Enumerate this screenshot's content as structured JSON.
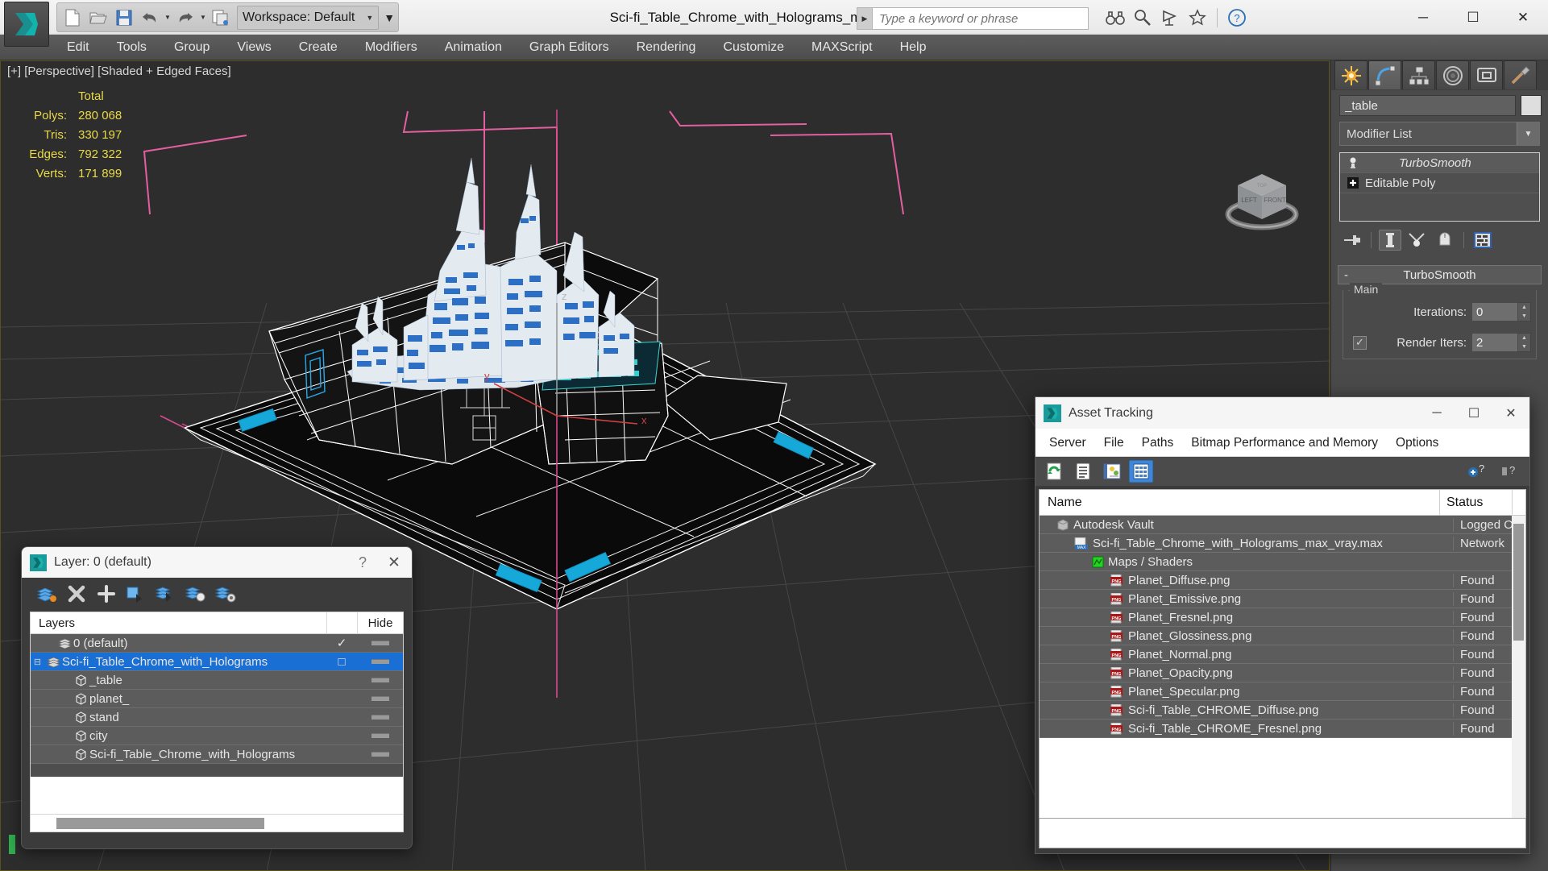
{
  "app": {
    "window_title": "Sci-fi_Table_Chrome_with_Holograms_max_vray.max",
    "workspace_label": "Workspace: Default",
    "search_placeholder": "Type a keyword or phrase",
    "quick_access": [
      {
        "name": "new-file-icon",
        "label": "New"
      },
      {
        "name": "open-file-icon",
        "label": "Open"
      },
      {
        "name": "save-file-icon",
        "label": "Save"
      },
      {
        "name": "undo-icon",
        "label": "Undo"
      },
      {
        "name": "redo-icon",
        "label": "Redo"
      },
      {
        "name": "project-folder-icon",
        "label": "Set Project Folder"
      }
    ],
    "toolbar_icons": [
      {
        "name": "binoculars-icon",
        "label": "Search"
      },
      {
        "name": "magnifier-icon",
        "label": "Find"
      },
      {
        "name": "satellite-dish-icon",
        "label": "Autodesk Online"
      },
      {
        "name": "star-icon",
        "label": "Favorites"
      },
      {
        "name": "help-icon",
        "label": "Help"
      }
    ],
    "window_buttons": [
      {
        "name": "minimize-button",
        "glyph": "─"
      },
      {
        "name": "maximize-button",
        "glyph": "☐"
      },
      {
        "name": "close-button",
        "glyph": "✕"
      }
    ]
  },
  "menubar": {
    "items": [
      "Edit",
      "Tools",
      "Group",
      "Views",
      "Create",
      "Modifiers",
      "Animation",
      "Graph Editors",
      "Rendering",
      "Customize",
      "MAXScript",
      "Help"
    ]
  },
  "viewport": {
    "label": "[+] [Perspective] [Shaded + Edged Faces]",
    "stats_header": "Total",
    "stats": [
      {
        "key": "Polys:",
        "value": "280 068"
      },
      {
        "key": "Tris:",
        "value": "330 197"
      },
      {
        "key": "Edges:",
        "value": "792 322"
      },
      {
        "key": "Verts:",
        "value": "171 899"
      }
    ],
    "axis_labels": {
      "x": "x",
      "y": "y",
      "z": "z"
    },
    "viewcube_faces": {
      "left": "LEFT",
      "front": "FRONT",
      "top": "TOP"
    }
  },
  "command_panel": {
    "tabs": [
      {
        "name": "create-tab",
        "label": "Create"
      },
      {
        "name": "modify-tab",
        "label": "Modify"
      },
      {
        "name": "hierarchy-tab",
        "label": "Hierarchy"
      },
      {
        "name": "motion-tab",
        "label": "Motion"
      },
      {
        "name": "display-tab",
        "label": "Display"
      },
      {
        "name": "utilities-tab",
        "label": "Utilities"
      }
    ],
    "active_tab_index": 1,
    "object_name": "_table",
    "object_color": "#dedede",
    "modifier_list_label": "Modifier List",
    "modifier_stack": [
      {
        "label": "TurboSmooth",
        "selected": true,
        "icon": "lightbulb-icon"
      },
      {
        "label": "Editable Poly",
        "selected": false,
        "icon": "plus-box-icon"
      }
    ],
    "stack_buttons": [
      {
        "name": "pin-stack-button"
      },
      {
        "name": "show-end-result-button"
      },
      {
        "name": "make-unique-button"
      },
      {
        "name": "remove-modifier-button"
      },
      {
        "name": "configure-modifier-sets-button"
      }
    ],
    "rollout": {
      "title": "TurboSmooth",
      "collapse_glyph": "-",
      "group_title": "Main",
      "fields": [
        {
          "label": "Iterations:",
          "value": "0",
          "checkbox": false
        },
        {
          "label": "Render Iters:",
          "value": "2",
          "checkbox": true
        }
      ]
    }
  },
  "layer_dialog": {
    "title": "Layer: 0 (default)",
    "help_glyph": "?",
    "close_glyph": "✕",
    "toolbar": [
      {
        "name": "set-active-layer-icon"
      },
      {
        "name": "delete-layer-icon"
      },
      {
        "name": "create-new-layer-icon"
      },
      {
        "name": "add-selection-to-layer-icon"
      },
      {
        "name": "select-objects-in-layer-icon"
      },
      {
        "name": "select-highlighted-layer-icon"
      },
      {
        "name": "layer-properties-icon"
      }
    ],
    "columns": [
      "Layers",
      "",
      "Hide"
    ],
    "rows": [
      {
        "name": "0 (default)",
        "indent": 1,
        "selected": false,
        "expander": "",
        "active": "✓",
        "icon": "layer-icon",
        "hide_dash": true
      },
      {
        "name": "Sci-fi_Table_Chrome_with_Holograms",
        "indent": 0,
        "selected": true,
        "expander": "⊟",
        "active": "□",
        "icon": "layer-icon",
        "hide_dash": true
      },
      {
        "name": "_table",
        "indent": 2,
        "selected": false,
        "expander": "",
        "active": "",
        "icon": "object-icon",
        "hide_dash": true
      },
      {
        "name": "planet_",
        "indent": 2,
        "selected": false,
        "expander": "",
        "active": "",
        "icon": "object-icon",
        "hide_dash": true
      },
      {
        "name": "stand",
        "indent": 2,
        "selected": false,
        "expander": "",
        "active": "",
        "icon": "object-icon",
        "hide_dash": true
      },
      {
        "name": "city",
        "indent": 2,
        "selected": false,
        "expander": "",
        "active": "",
        "icon": "object-icon",
        "hide_dash": true
      },
      {
        "name": "Sci-fi_Table_Chrome_with_Holograms",
        "indent": 2,
        "selected": false,
        "expander": "",
        "active": "",
        "icon": "object-icon",
        "hide_dash": true
      }
    ]
  },
  "asset_tracking": {
    "title": "Asset Tracking",
    "window_buttons": [
      {
        "name": "at-minimize-button",
        "glyph": "─"
      },
      {
        "name": "at-maximize-button",
        "glyph": "☐"
      },
      {
        "name": "at-close-button",
        "glyph": "✕"
      }
    ],
    "menu": [
      "Server",
      "File",
      "Paths",
      "Bitmap Performance and Memory",
      "Options"
    ],
    "toolbar": [
      {
        "name": "refresh-icon",
        "selected": false
      },
      {
        "name": "list-view-icon",
        "selected": false
      },
      {
        "name": "details-view-icon",
        "selected": false
      },
      {
        "name": "grid-view-icon",
        "selected": true
      }
    ],
    "help_icons": [
      {
        "name": "add-help-icon"
      },
      {
        "name": "question-help-icon"
      }
    ],
    "columns": [
      "Name",
      "Status"
    ],
    "rows": [
      {
        "name": "Autodesk Vault",
        "status": "Logged O",
        "indent": 0,
        "icon": "vault-icon"
      },
      {
        "name": "Sci-fi_Table_Chrome_with_Holograms_max_vray.max",
        "status": "Network",
        "indent": 1,
        "icon": "max-file-icon"
      },
      {
        "name": "Maps / Shaders",
        "status": "",
        "indent": 2,
        "icon": "maps-icon"
      },
      {
        "name": "Planet_Diffuse.png",
        "status": "Found",
        "indent": 3,
        "icon": "png-icon"
      },
      {
        "name": "Planet_Emissive.png",
        "status": "Found",
        "indent": 3,
        "icon": "png-icon"
      },
      {
        "name": "Planet_Fresnel.png",
        "status": "Found",
        "indent": 3,
        "icon": "png-icon"
      },
      {
        "name": "Planet_Glossiness.png",
        "status": "Found",
        "indent": 3,
        "icon": "png-icon"
      },
      {
        "name": "Planet_Normal.png",
        "status": "Found",
        "indent": 3,
        "icon": "png-icon"
      },
      {
        "name": "Planet_Opacity.png",
        "status": "Found",
        "indent": 3,
        "icon": "png-icon"
      },
      {
        "name": "Planet_Specular.png",
        "status": "Found",
        "indent": 3,
        "icon": "png-icon"
      },
      {
        "name": "Sci-fi_Table_CHROME_Diffuse.png",
        "status": "Found",
        "indent": 3,
        "icon": "png-icon"
      },
      {
        "name": "Sci-fi_Table_CHROME_Fresnel.png",
        "status": "Found",
        "indent": 3,
        "icon": "png-icon"
      }
    ]
  },
  "colors": {
    "viewport_bg": "#2d2d2d",
    "stats_text": "#e9d94a",
    "selection_blue": "#1a6fd4",
    "hologram_blue": "#2f6fc4",
    "hologram_cyan": "#2fc4c4",
    "gizmo_pink": "#e54e9a",
    "accent_teal": "#1c9d9d"
  }
}
